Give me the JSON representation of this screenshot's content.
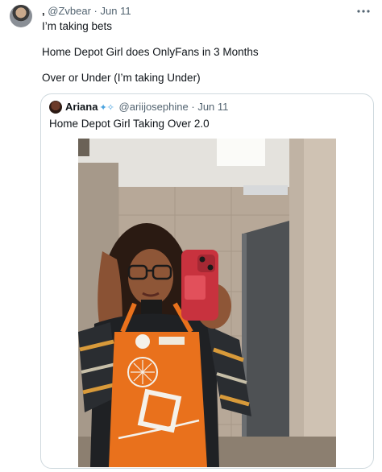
{
  "tweet": {
    "display_name": ",",
    "handle": "@Zvbear",
    "separator": "·",
    "date": "Jun 11",
    "more_icon": "more-horizontal-icon",
    "lines": [
      "I’m taking bets",
      "Home Depot Girl does OnlyFans in 3 Months",
      "Over or Under (I’m taking Under)"
    ]
  },
  "quoted": {
    "display_name": "Ariana",
    "badge_icon": "sparkle-badge-icon",
    "handle": "@ariijosephine",
    "separator": "·",
    "date": "Jun 11",
    "text": "Home Depot Girl Taking Over 2.0",
    "image_alt": "Mirror selfie of a woman in an orange Home Depot apron holding a red phone in a restroom"
  },
  "colors": {
    "apron": "#e9711c",
    "phone": "#c8323e",
    "muted_text": "#536471",
    "border": "#cfd9de"
  }
}
